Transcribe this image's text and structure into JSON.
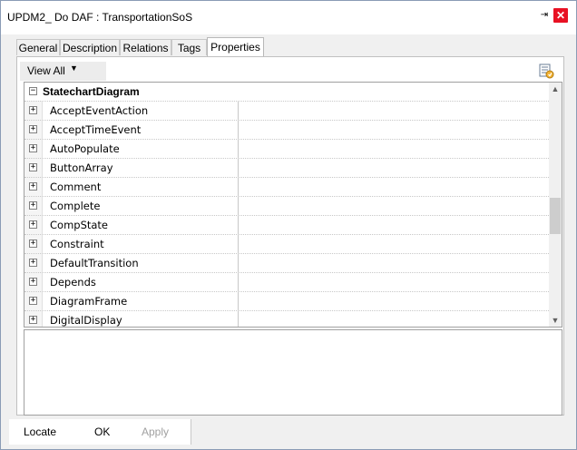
{
  "window": {
    "title": "UPDM2_ Do DAF : TransportationSoS",
    "pin_glyph": "⇥",
    "close_glyph": "✕"
  },
  "tabs": [
    {
      "label": "General",
      "active": false
    },
    {
      "label": "Description",
      "active": false
    },
    {
      "label": "Relations",
      "active": false
    },
    {
      "label": "Tags",
      "active": false
    },
    {
      "label": "Properties",
      "active": true
    }
  ],
  "toolbar": {
    "view_all_label": "View All",
    "caret_glyph": "▼",
    "options_icon": "properties-options-icon"
  },
  "grid": {
    "category_label": "StatechartDiagram",
    "collapse_glyph": "−",
    "expand_glyph": "+",
    "rows": [
      {
        "label": "AcceptEventAction",
        "value": ""
      },
      {
        "label": "AcceptTimeEvent",
        "value": ""
      },
      {
        "label": "AutoPopulate",
        "value": ""
      },
      {
        "label": "ButtonArray",
        "value": ""
      },
      {
        "label": "Comment",
        "value": ""
      },
      {
        "label": "Complete",
        "value": ""
      },
      {
        "label": "CompState",
        "value": ""
      },
      {
        "label": "Constraint",
        "value": ""
      },
      {
        "label": "DefaultTransition",
        "value": ""
      },
      {
        "label": "Depends",
        "value": ""
      },
      {
        "label": "DiagramFrame",
        "value": ""
      },
      {
        "label": "DigitalDisplay",
        "value": ""
      }
    ],
    "scroll_up_glyph": "▲",
    "scroll_down_glyph": "▼"
  },
  "buttons": {
    "locate": "Locate",
    "ok": "OK",
    "apply": "Apply"
  },
  "colors": {
    "close_bg": "#e81123",
    "window_border": "#8a9bb5"
  }
}
